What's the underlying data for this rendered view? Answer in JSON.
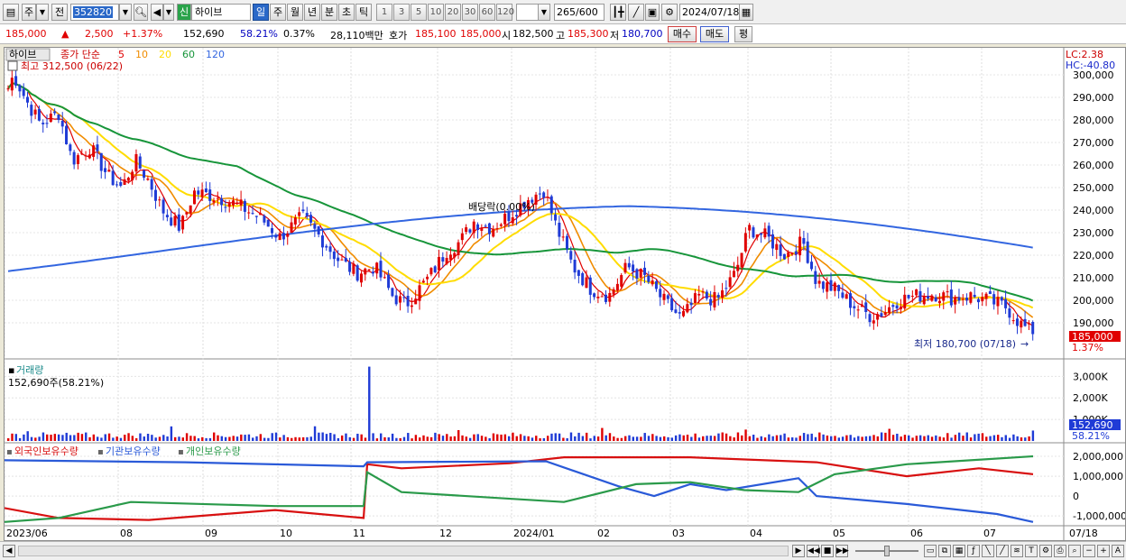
{
  "toolbar": {
    "market_main": "주",
    "market_all": "전",
    "code": "352820",
    "new_label": "신",
    "name": "하이브",
    "periods": [
      "일",
      "주",
      "월",
      "년",
      "분",
      "초",
      "틱"
    ],
    "active_period": "일",
    "intervals": [
      "1",
      "3",
      "5",
      "10",
      "20",
      "30",
      "60",
      "120"
    ],
    "count": "265",
    "count_max": "/600",
    "date": "2024/07/18"
  },
  "quote": {
    "price": "185,000",
    "change": "2,500",
    "change_pct": "+1.37%",
    "volume": "152,690",
    "vol_ratio": "58.21%",
    "turnover_pct": "0.37%",
    "amount": "28,110백만",
    "bid_label": "호가",
    "ask_price": "185,100",
    "bid_price": "185,000",
    "open_label": "시",
    "open": "182,500",
    "high_label": "고",
    "high": "185,300",
    "low_label": "저",
    "low": "180,700",
    "buy_label": "매수",
    "sell_label": "매도",
    "eval_label": "평"
  },
  "price_panel": {
    "name_tag": "하이브",
    "ma_title": "종가 단순",
    "ma_periods": [
      "5",
      "10",
      "20",
      "60",
      "120"
    ],
    "ma_colors": [
      "#e00000",
      "#f08c00",
      "#ffdc00",
      "#17953a",
      "#3366e0"
    ],
    "high_note": "최고 312,500 (06/22)",
    "low_note": "최저 180,700 (07/18)",
    "dividend_note": "배당락(0.00%)",
    "lc": "LC:2.38",
    "hc": "HC:-40.80",
    "price_tag": "185,000",
    "pct_tag": "1.37%",
    "y_labels": [
      "300,000",
      "290,000",
      "280,000",
      "270,000",
      "260,000",
      "250,000",
      "240,000",
      "230,000",
      "220,000",
      "210,000",
      "200,000",
      "190,000"
    ]
  },
  "volume_panel": {
    "title": "거래량",
    "value": "152,690주(58.21%)",
    "y_labels": [
      "3,000K",
      "2,000K",
      "1,000K"
    ],
    "tag_value": "152,690",
    "tag_pct": "58.21%"
  },
  "holdings_panel": {
    "series_names": [
      "외국인보유수량",
      "기관보유수량",
      "개인보유수량"
    ],
    "series_colors": [
      "#d81010",
      "#2a5ad8",
      "#2a9a4a"
    ],
    "y_labels": [
      "2,000,000",
      "1,000,000",
      "0",
      "-1,000,000"
    ]
  },
  "x_axis": {
    "labels": [
      "2023/06",
      "08",
      "09",
      "10",
      "11",
      "12",
      "2024/01",
      "02",
      "03",
      "04",
      "05",
      "06",
      "07"
    ],
    "right_label": "07/18"
  },
  "colors": {
    "up": "#e00000",
    "down": "#1f3bd6",
    "active_tab": "#2a68c8"
  }
}
